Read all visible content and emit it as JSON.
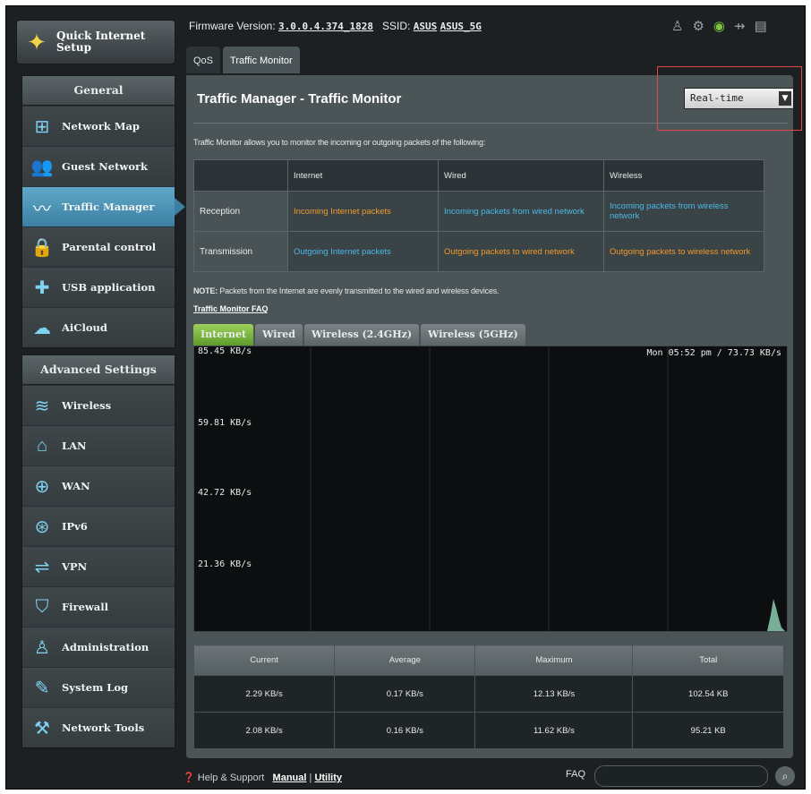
{
  "sidebar": {
    "quick_setup": "Quick Internet\nSetup",
    "general_heading": "General",
    "general_items": [
      {
        "label": "Network Map",
        "icon": "network-map-icon"
      },
      {
        "label": "Guest Network",
        "icon": "guest-network-icon"
      },
      {
        "label": "Traffic Manager",
        "icon": "traffic-manager-icon",
        "active": true
      },
      {
        "label": "Parental control",
        "icon": "lock-icon"
      },
      {
        "label": "USB application",
        "icon": "puzzle-icon"
      },
      {
        "label": "AiCloud",
        "icon": "cloud-house-icon"
      }
    ],
    "advanced_heading": "Advanced Settings",
    "advanced_items": [
      {
        "label": "Wireless",
        "icon": "wifi-icon"
      },
      {
        "label": "LAN",
        "icon": "house-icon"
      },
      {
        "label": "WAN",
        "icon": "globe-icon"
      },
      {
        "label": "IPv6",
        "icon": "globe-ipv6-icon"
      },
      {
        "label": "VPN",
        "icon": "vpn-icon"
      },
      {
        "label": "Firewall",
        "icon": "shield-icon"
      },
      {
        "label": "Administration",
        "icon": "person-icon"
      },
      {
        "label": "System Log",
        "icon": "log-icon"
      },
      {
        "label": "Network Tools",
        "icon": "tools-icon"
      }
    ]
  },
  "header": {
    "firmware_label": "Firmware Version:",
    "firmware_value": "3.0.0.4.374_1828",
    "ssid_label": "SSID:",
    "ssid_1": "ASUS",
    "ssid_2": "ASUS_5G"
  },
  "tabs": [
    "QoS",
    "Traffic Monitor"
  ],
  "main": {
    "title": "Traffic Manager - Traffic Monitor",
    "mode_select": "Real-time",
    "description": "Traffic Monitor allows you to monitor the incoming or outgoing packets of the following:",
    "table": {
      "headers": [
        "",
        "Internet",
        "Wired",
        "Wireless"
      ],
      "rows": [
        {
          "label": "Reception",
          "cells": [
            "Incoming Internet packets",
            "Incoming packets from wired network",
            "Incoming packets from wireless network"
          ]
        },
        {
          "label": "Transmission",
          "cells": [
            "Outgoing Internet packets",
            "Outgoing packets to wired network",
            "Outgoing packets to wireless network"
          ]
        }
      ]
    },
    "note_label": "NOTE:",
    "note_text": " Packets from the Internet are evenly transmitted to the wired and wireless devices.",
    "faq_link": "Traffic Monitor FAQ",
    "graph_tabs": [
      "Internet",
      "Wired",
      "Wireless (2.4GHz)",
      "Wireless (5GHz)"
    ],
    "graph": {
      "y_labels": [
        "85.45 KB/s",
        "59.81 KB/s",
        "42.72 KB/s",
        "21.36 KB/s"
      ],
      "timestamp": "Mon 05:52 pm / 73.73 KB/s"
    },
    "stats": {
      "headers": [
        "Current",
        "Average",
        "Maximum",
        "Total"
      ],
      "rows": [
        [
          "2.29 KB/s",
          "0.17 KB/s",
          "12.13 KB/s",
          "102.54 KB"
        ],
        [
          "2.08 KB/s",
          "0.16 KB/s",
          "11.62 KB/s",
          "95.21 KB"
        ]
      ]
    }
  },
  "footer": {
    "help": "Help & Support",
    "manual": "Manual",
    "separator": "|",
    "utility": "Utility",
    "faq": "FAQ"
  },
  "colors": {
    "incoming": "#f09a2e",
    "outgoing": "#4cb9e8",
    "active_nav": "#3c7fa2",
    "accent_green": "#5d9b2c"
  }
}
